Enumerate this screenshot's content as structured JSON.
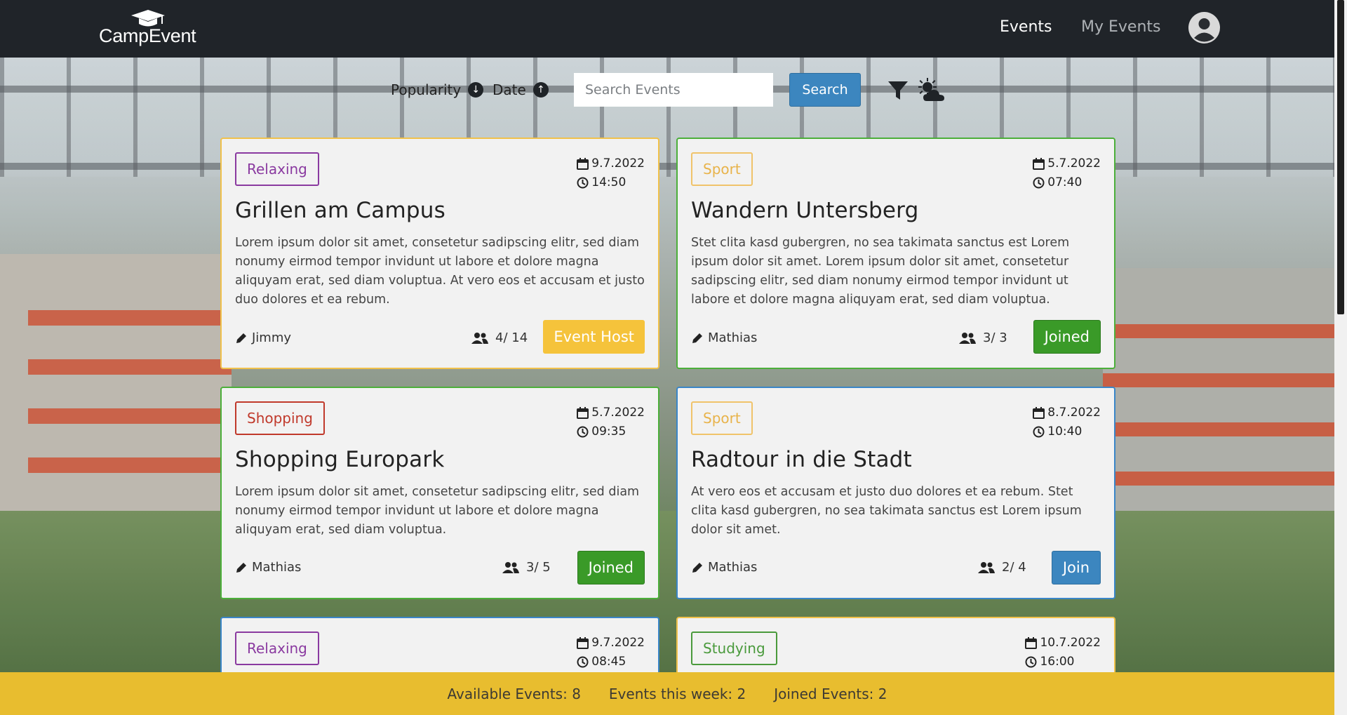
{
  "app": {
    "logo_text": "CampEvent"
  },
  "nav": {
    "events_label": "Events",
    "my_events_label": "My Events"
  },
  "toolbar": {
    "sort_popularity_label": "Popularity",
    "sort_date_label": "Date",
    "search_placeholder": "Search Events",
    "search_value": "",
    "search_button_label": "Search"
  },
  "events": [
    {
      "category": "Relaxing",
      "date": "9.7.2022",
      "time": "14:50",
      "title": "Grillen am Campus",
      "description": "Lorem ipsum dolor sit amet, consetetur sadipscing elitr, sed diam nonumy eirmod tempor invidunt ut labore et dolore magna aliquyam erat, sed diam voluptua. At vero eos et accusam et justo duo dolores et ea rebum.",
      "author": "Jimmy",
      "members": "4/ 14",
      "action": "Event Host"
    },
    {
      "category": "Sport",
      "date": "5.7.2022",
      "time": "07:40",
      "title": "Wandern Untersberg",
      "description": "Stet clita kasd gubergren, no sea takimata sanctus est Lorem ipsum dolor sit amet. Lorem ipsum dolor sit amet, consetetur sadipscing elitr, sed diam nonumy eirmod tempor invidunt ut labore et dolore magna aliquyam erat, sed diam voluptua.",
      "author": "Mathias",
      "members": "3/ 3",
      "action": "Joined"
    },
    {
      "category": "Shopping",
      "date": "5.7.2022",
      "time": "09:35",
      "title": "Shopping Europark",
      "description": "Lorem ipsum dolor sit amet, consetetur sadipscing elitr, sed diam nonumy eirmod tempor invidunt ut labore et dolore magna aliquyam erat, sed diam voluptua.",
      "author": "Mathias",
      "members": "3/ 5",
      "action": "Joined"
    },
    {
      "category": "Sport",
      "date": "8.7.2022",
      "time": "10:40",
      "title": "Radtour in die Stadt",
      "description": "At vero eos et accusam et justo duo dolores et ea rebum. Stet clita kasd gubergren, no sea takimata sanctus est Lorem ipsum dolor sit amet.",
      "author": "Mathias",
      "members": "2/ 4",
      "action": "Join"
    },
    {
      "category": "Relaxing",
      "date": "9.7.2022",
      "time": "08:45"
    },
    {
      "category": "Studying",
      "date": "10.7.2022",
      "time": "16:00"
    }
  ],
  "footer": {
    "available_events": "Available Events: 8",
    "events_this_week": "Events this week: 2",
    "joined_events": "Joined Events: 2"
  }
}
